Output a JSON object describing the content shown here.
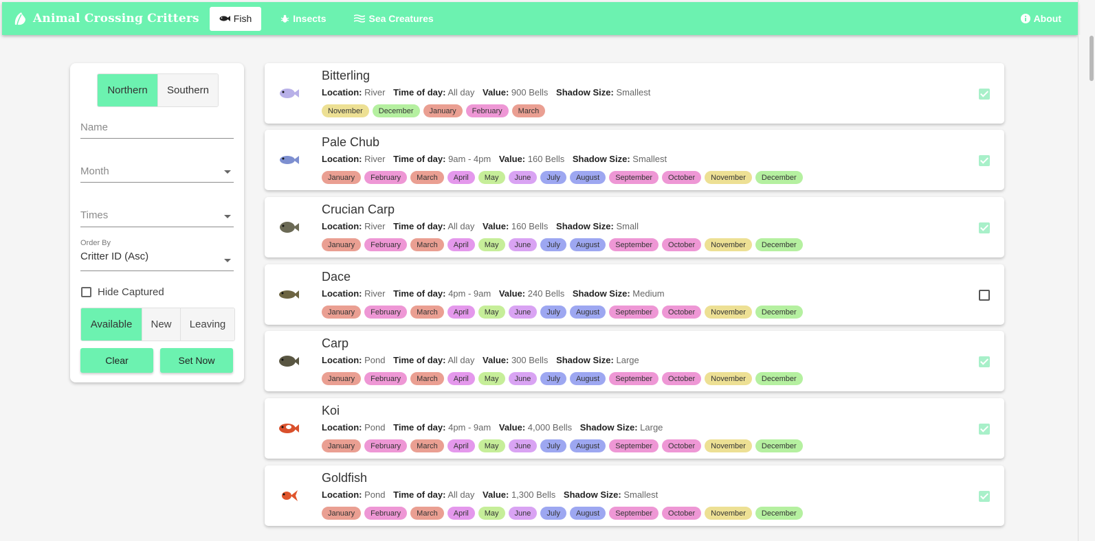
{
  "app": {
    "title": "Animal Crossing Critters"
  },
  "nav": {
    "fish": "Fish",
    "insects": "Insects",
    "sea": "Sea Creatures",
    "about": "About"
  },
  "filters": {
    "northern": "Northern",
    "southern": "Southern",
    "name_placeholder": "Name",
    "month_placeholder": "Month",
    "times_placeholder": "Times",
    "order_label": "Order By",
    "order_value": "Critter ID (Asc)",
    "hide_captured": "Hide Captured",
    "available": "Available",
    "new": "New",
    "leaving": "Leaving",
    "clear": "Clear",
    "set_now": "Set Now"
  },
  "labels": {
    "location": "Location:",
    "time": "Time of day:",
    "value": "Value:",
    "shadow": "Shadow Size:"
  },
  "month_colors": {
    "January": "#ea9f92",
    "February": "#ee97d5",
    "March": "#ea9f92",
    "April": "#e498ec",
    "May": "#c6ee99",
    "June": "#d9a3f3",
    "July": "#9da7f1",
    "August": "#9da7f1",
    "September": "#ee97d5",
    "October": "#ee97d5",
    "November": "#ede094",
    "December": "#b5f0a0"
  },
  "critters": [
    {
      "name": "Bitterling",
      "location": "River",
      "time": "All day",
      "value": "900 Bells",
      "shadow": "Smallest",
      "captured": true,
      "color": "#b8b0e8",
      "months": [
        "November",
        "December",
        "January",
        "February",
        "March"
      ]
    },
    {
      "name": "Pale Chub",
      "location": "River",
      "time": "9am - 4pm",
      "value": "160 Bells",
      "shadow": "Smallest",
      "captured": true,
      "color": "#7d8fd0",
      "months": [
        "January",
        "February",
        "March",
        "April",
        "May",
        "June",
        "July",
        "August",
        "September",
        "October",
        "November",
        "December"
      ]
    },
    {
      "name": "Crucian Carp",
      "location": "River",
      "time": "All day",
      "value": "160 Bells",
      "shadow": "Small",
      "captured": true,
      "color": "#6b6a55",
      "months": [
        "January",
        "February",
        "March",
        "April",
        "May",
        "June",
        "July",
        "August",
        "September",
        "October",
        "November",
        "December"
      ]
    },
    {
      "name": "Dace",
      "location": "River",
      "time": "4pm - 9am",
      "value": "240 Bells",
      "shadow": "Medium",
      "captured": false,
      "color": "#6d6542",
      "months": [
        "January",
        "February",
        "March",
        "April",
        "May",
        "June",
        "July",
        "August",
        "September",
        "October",
        "November",
        "December"
      ]
    },
    {
      "name": "Carp",
      "location": "Pond",
      "time": "All day",
      "value": "300 Bells",
      "shadow": "Large",
      "captured": true,
      "color": "#595642",
      "months": [
        "January",
        "February",
        "March",
        "April",
        "May",
        "June",
        "July",
        "August",
        "September",
        "October",
        "November",
        "December"
      ]
    },
    {
      "name": "Koi",
      "location": "Pond",
      "time": "4pm - 9am",
      "value": "4,000 Bells",
      "shadow": "Large",
      "captured": true,
      "color": "#d9502c",
      "months": [
        "January",
        "February",
        "March",
        "April",
        "May",
        "June",
        "July",
        "August",
        "September",
        "October",
        "November",
        "December"
      ]
    },
    {
      "name": "Goldfish",
      "location": "Pond",
      "time": "All day",
      "value": "1,300 Bells",
      "shadow": "Smallest",
      "captured": true,
      "color": "#e0552c",
      "months": [
        "January",
        "February",
        "March",
        "April",
        "May",
        "June",
        "July",
        "August",
        "September",
        "October",
        "November",
        "December"
      ]
    }
  ]
}
